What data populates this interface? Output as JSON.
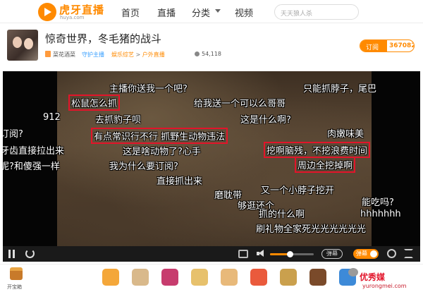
{
  "header": {
    "brand_name": "虎牙直播",
    "brand_domain": "huya.com",
    "nav": [
      "首页",
      "直播",
      "分类",
      "视频"
    ],
    "search_placeholder": "天天狼人杀"
  },
  "room": {
    "title": "惊奇世界，冬毛猪的战斗",
    "host_name": "菜花酒菜",
    "guard_badge": "守护主播",
    "breadcrumb": [
      "娱乐综艺",
      ">",
      "户外直播"
    ],
    "viewer_count": "54,118",
    "subscribe_label": "订阅",
    "subscribe_count": "367082"
  },
  "danmaku": [
    {
      "text": "主播你送我一个吧?",
      "boxed": false
    },
    {
      "text": "只能抓脖子，尾巴",
      "boxed": false
    },
    {
      "text": "松鼠怎么抓",
      "boxed": true
    },
    {
      "text": "给我送一个可以么哥哥",
      "boxed": false
    },
    {
      "text": "912",
      "boxed": false
    },
    {
      "text": "去抓豹子呗",
      "boxed": false
    },
    {
      "text": "这是什么啊?",
      "boxed": false
    },
    {
      "text": "订阅?",
      "boxed": false
    },
    {
      "text": "有点常识行不行 抓野生动物违法",
      "boxed": true
    },
    {
      "text": "肉嫩味美",
      "boxed": false
    },
    {
      "text": "牙齿直接拉出来",
      "boxed": false
    },
    {
      "text": "这是啥动物了?心手",
      "boxed": false
    },
    {
      "text": "挖啊脑残，不挖浪费时间",
      "boxed": true
    },
    {
      "text": "呢?和傻强一样",
      "boxed": false
    },
    {
      "text": "我为什么要订阅?",
      "boxed": false
    },
    {
      "text": "周边全挖掉啊",
      "boxed": true
    },
    {
      "text": "直接抓出来",
      "boxed": false
    },
    {
      "text": "磨耽带",
      "boxed": false
    },
    {
      "text": "又一个小脖子挖开",
      "boxed": false
    },
    {
      "text": "能吃吗?",
      "boxed": false
    },
    {
      "text": "够逛还个",
      "boxed": false
    },
    {
      "text": "抓的什么啊",
      "boxed": false
    },
    {
      "text": "hhhhhhh",
      "boxed": false
    },
    {
      "text": "刷礼物全家死光光光光光光",
      "boxed": false
    }
  ],
  "controls": {
    "volume_level": 0.45,
    "danmu_label": "弹幕",
    "toggle_label": "弹幕"
  },
  "giftbar": {
    "chest_label": "开宝箱",
    "gift_colors": [
      "#f4a73a",
      "#d9b98b",
      "#c73c6e",
      "#e7c16c",
      "#e8b97a",
      "#ea5a3c",
      "#caa04d",
      "#7a4a2a",
      "#3d8ad8"
    ],
    "watermark": "优秀媒",
    "watermark_url": "yurongmei.com"
  },
  "colors": {
    "brand": "#ff8a00",
    "danmaku_box": "#e2142a"
  }
}
